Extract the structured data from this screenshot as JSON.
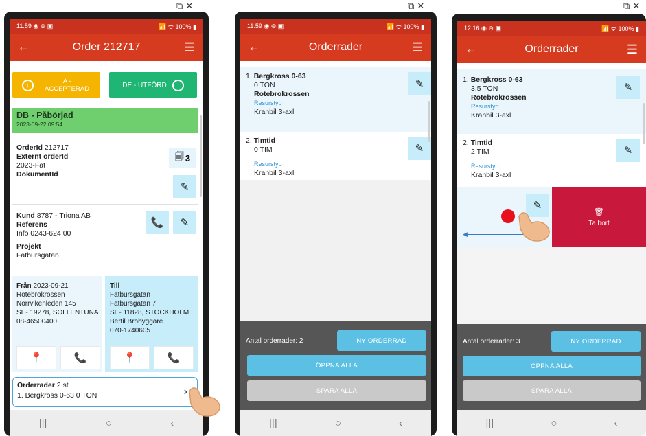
{
  "window_icons": "⧉ ✕",
  "phone1": {
    "status_time": "11:59",
    "status_icons": "◉ ⊖ ▣",
    "status_right": "📶 ᯤ 100% ▮",
    "title": "Order 212717",
    "btn_accept": "A -\nACCEPTERAD",
    "btn_done": "DE - UTFÖRD",
    "status_title": "DB - Påbörjad",
    "status_date": "2023-09-22 09:54",
    "order_id_label": "OrderId",
    "order_id": "212717",
    "ext_order_label": "Externt orderId",
    "ext_order": "2023-Fat",
    "doc_label": "DokumentId",
    "doc_count": "3",
    "kund_label": "Kund",
    "kund": "8787 - Triona AB",
    "ref_label": "Referens",
    "info": "Info  0243-624 00",
    "projekt_label": "Projekt",
    "projekt": "Fatbursgatan",
    "fran_label": "Från",
    "fran_date": "2023-09-21",
    "fran_lines": [
      "Rotebrokrossen",
      "Norrvikenleden 145",
      "SE- 19278, SOLLENTUNA",
      "08-46500400"
    ],
    "till_label": "Till",
    "till_lines": [
      "Fatbursgatan",
      "Fatbursgatan 7",
      "SE- 11828, STOCKHOLM",
      "Bertil Brobyggare",
      "070-1740605"
    ],
    "orderrader_label": "Orderrader",
    "orderrader_count": "2 st",
    "orderrader_first": "1. Bergkross 0-63 0 TON"
  },
  "phone2": {
    "status_time": "11:59",
    "title": "Orderrader",
    "rows": [
      {
        "num": "1.",
        "name": "Bergkross 0-63",
        "qty": "0 TON",
        "supplier": "Rotebrokrossen",
        "restype_label": "Resurstyp",
        "restype": "Kranbil 3-axl"
      },
      {
        "num": "2.",
        "name": "Timtid",
        "qty": "0 TIM",
        "supplier": "",
        "restype_label": "Resurstyp",
        "restype": "Kranbil 3-axl"
      }
    ],
    "count_text": "Antal orderrader: 2",
    "btn_new": "NY ORDERRAD",
    "btn_open": "ÖPPNA ALLA",
    "btn_save": "SPARA ALLA"
  },
  "phone3": {
    "status_time": "12:16",
    "title": "Orderrader",
    "rows": [
      {
        "num": "1.",
        "name": "Bergkross 0-63",
        "qty": "3,5 TON",
        "supplier": "Rotebrokrossen",
        "restype_label": "Resurstyp",
        "restype": "Kranbil 3-axl"
      },
      {
        "num": "2.",
        "name": "Timtid",
        "qty": "2 TIM",
        "supplier": "",
        "restype_label": "Resurstyp",
        "restype": "Kranbil 3-axl"
      }
    ],
    "delete_label": "Ta bort",
    "count_text": "Antal orderrader: 3",
    "btn_new": "NY ORDERRAD",
    "btn_open": "ÖPPNA ALLA",
    "btn_save": "SPARA ALLA"
  },
  "nav": {
    "recent": "|||",
    "home": "○",
    "back": "‹"
  },
  "colors": {
    "appbar": "#d63a1f",
    "status_green": "#6fcf6f",
    "accept": "#f5b400",
    "done": "#1fb573",
    "delete": "#c8193c",
    "edit_btn": "#c7ecfa",
    "footer_blue": "#5bc0e3"
  }
}
